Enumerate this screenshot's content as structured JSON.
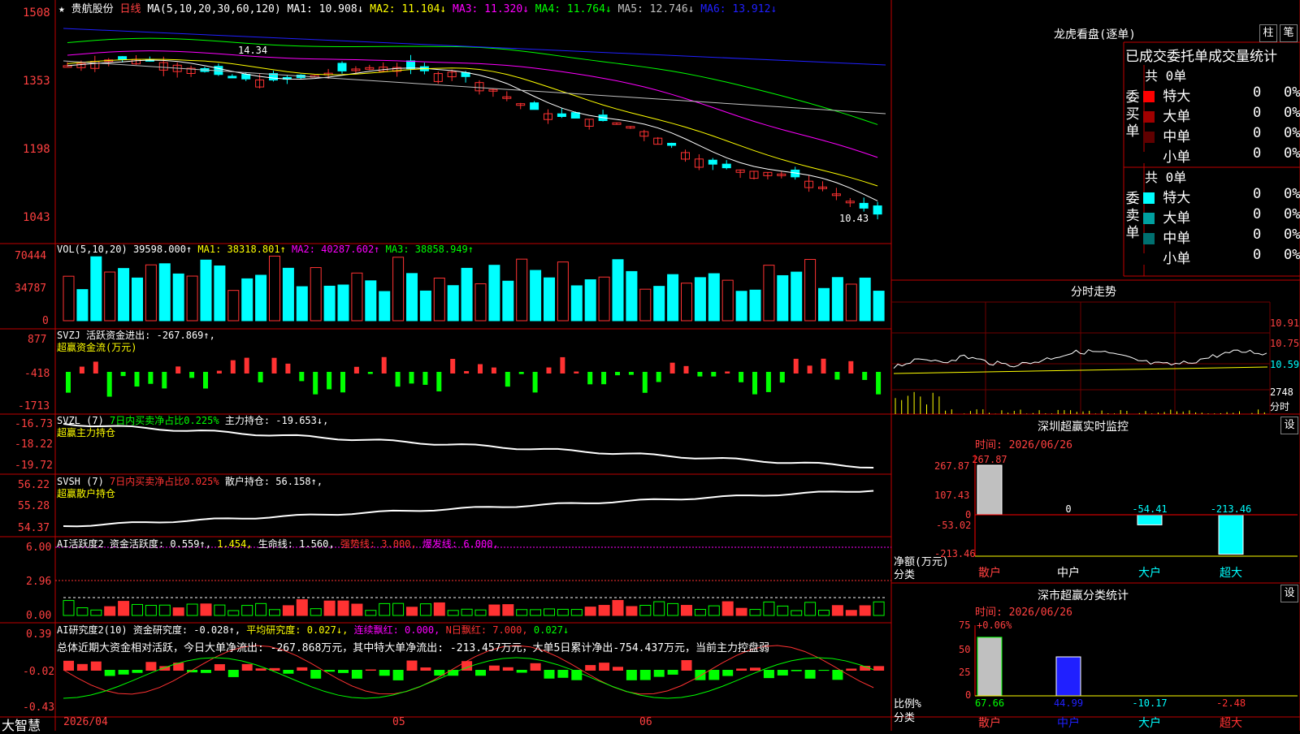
{
  "header": {
    "star_glyph": "★",
    "stock_name": "贵航股份",
    "period": "日线",
    "ma_label": "MA(5,10,20,30,60,120)",
    "ma_values": [
      {
        "text": "MA1: 10.908↓",
        "color": "#ffffff"
      },
      {
        "text": "MA2: 11.104↓",
        "color": "#ffff00"
      },
      {
        "text": "MA3: 11.320↓",
        "color": "#ff00ff"
      },
      {
        "text": "MA4: 11.764↓",
        "color": "#00ff00"
      },
      {
        "text": "MA5: 12.746↓",
        "color": "#c0c0c0"
      },
      {
        "text": "MA6: 13.912↓",
        "color": "#2020ff"
      }
    ]
  },
  "price_panel": {
    "y_ticks": [
      "1508",
      "1353",
      "1198",
      "1043"
    ],
    "high_label": "14.34",
    "low_label": "10.43"
  },
  "panels": {
    "vol": {
      "title": "VOL(5,10,20)",
      "value": "39598.000↑",
      "ma": [
        {
          "text": "MA1: 38318.801↑",
          "color": "#ffff00"
        },
        {
          "text": "MA2: 40287.602↑",
          "color": "#ff00ff"
        },
        {
          "text": "MA3: 38858.949↑",
          "color": "#00ff00"
        }
      ],
      "y_ticks": [
        "70444",
        "34787",
        "0"
      ]
    },
    "svzj": {
      "title": "SVZJ",
      "line1": "活跃资金进出: -267.869↑,",
      "line2": "超赢资金流(万元)",
      "y_ticks": [
        "877",
        "-418",
        "-1713"
      ]
    },
    "svzl": {
      "title": "SVZL (7)",
      "green_text": "7日内买卖净占比0.225%",
      "main_text": "主力持仓: -19.653↓,",
      "line2": "超赢主力持仓",
      "y_ticks": [
        "-16.73",
        "-18.22",
        "-19.72"
      ]
    },
    "svsh": {
      "title": "SVSH (7)",
      "red_text": "7日内买卖净占比0.025%",
      "main_text": "散户持仓: 56.158↑,",
      "line2": "超赢散户持仓",
      "y_ticks": [
        "56.22",
        "55.28",
        "54.37"
      ]
    },
    "ai1": {
      "title": "AI活跃度2",
      "t1": "资金活跃度: 0.559↑,",
      "t2": "1.454,",
      "t3": "生命线: 1.560,",
      "t4": "强势线: 3.000,",
      "t5": "爆发线: 6.000,",
      "y_ticks": [
        "6.00",
        "2.96",
        "0.00"
      ]
    },
    "ai2": {
      "title": "AI研究度2(10)",
      "t1": "资金研究度: -0.028↑,",
      "t2": "平均研究度: 0.027↓,",
      "t3": "连续飘红: 0.000,",
      "t4": "N日飘红: 7.000,",
      "t5": "0.027↓",
      "summary": "总体近期大资金相对活跃，今日大单净流出: -267.868万元，其中特大单净流出: -213.457万元，大单5日累计净出-754.437万元，当前主力控盘弱",
      "y_ticks": [
        "0.39",
        "-0.02",
        "-0.43"
      ]
    }
  },
  "x_axis": {
    "labels": [
      "2026/04",
      "05",
      "06"
    ]
  },
  "footer": {
    "brand": "大智慧"
  },
  "right": {
    "title": "龙虎看盘(逐单)",
    "btn_bar": "柱",
    "btn_line": "笔",
    "subtitle": "已成交委托单成交量统计",
    "buy": {
      "side_label": "委买单",
      "total": "共 0单",
      "rows": [
        {
          "label": "特大",
          "count": "0",
          "pct": "0%",
          "color": "#ff0000"
        },
        {
          "label": "大单",
          "count": "0",
          "pct": "0%",
          "color": "#a00000"
        },
        {
          "label": "中单",
          "count": "0",
          "pct": "0%",
          "color": "#600000"
        },
        {
          "label": "小单",
          "count": "0",
          "pct": "0%",
          "color": "#000000"
        }
      ]
    },
    "sell": {
      "side_label": "委卖单",
      "total": "共 0单",
      "rows": [
        {
          "label": "特大",
          "count": "0",
          "pct": "0%",
          "color": "#00ffff"
        },
        {
          "label": "大单",
          "count": "0",
          "pct": "0%",
          "color": "#00a0a0"
        },
        {
          "label": "中单",
          "count": "0",
          "pct": "0%",
          "color": "#007070"
        },
        {
          "label": "小单",
          "count": "0",
          "pct": "0%",
          "color": "#000000"
        }
      ]
    },
    "intraday": {
      "title": "分时走势",
      "y_ticks": [
        "10.91",
        "10.75",
        "10.59"
      ],
      "vol_label": "2748",
      "foot_label": "分时"
    },
    "monitor": {
      "title": "深圳超赢实时监控",
      "btn": "设",
      "time": "时间: 2026/06/26",
      "y_ticks": [
        "267.87",
        "107.43",
        "0",
        "-53.02",
        "-213.46"
      ],
      "ylabel": "净额(万元)",
      "xlabel": "分类",
      "bars": [
        {
          "cat": "散户",
          "label": "267.87",
          "value": 267.87
        },
        {
          "cat": "中户",
          "label": "0",
          "value": 0
        },
        {
          "cat": "大户",
          "label": "-54.41",
          "value": -54.41
        },
        {
          "cat": "超大",
          "label": "-213.46",
          "value": -213.46
        }
      ]
    },
    "stats": {
      "title": "深市超赢分类统计",
      "btn": "设",
      "time": "时间: 2026/06/26",
      "top_label": "+0.06%",
      "y_ticks": [
        "75",
        "50",
        "25",
        "0"
      ],
      "ylabel": "比例%",
      "xlabel": "分类",
      "bars": [
        {
          "cat": "散户",
          "label": "67.66",
          "value": 67.66
        },
        {
          "cat": "中户",
          "label": "44.99",
          "value": 44.99
        },
        {
          "cat": "大户",
          "label": "-10.17",
          "value": -10.17
        },
        {
          "cat": "超大",
          "label": "-2.48",
          "value": -2.48
        }
      ]
    }
  },
  "colors": {
    "up": "#ff3232",
    "down": "#00ffff",
    "frame": "#ff0000",
    "grid": "#800000"
  }
}
